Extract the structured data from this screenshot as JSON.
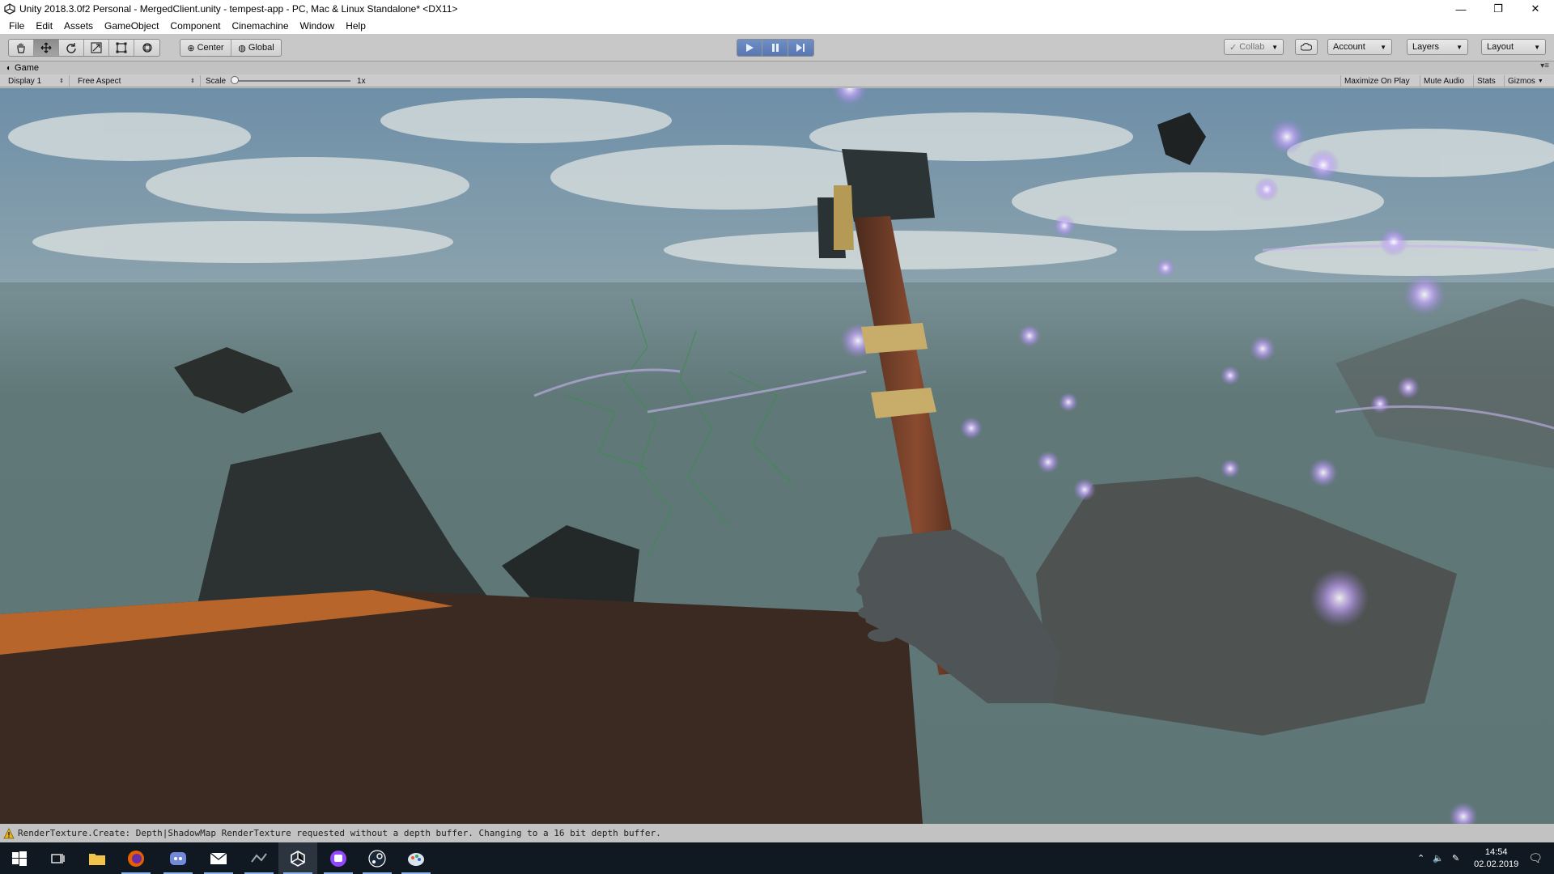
{
  "window": {
    "title": "Unity 2018.3.0f2 Personal - MergedClient.unity - tempest-app - PC, Mac & Linux Standalone* <DX11>",
    "minimize": "—",
    "maximize": "❐",
    "close": "✕"
  },
  "menu": [
    "File",
    "Edit",
    "Assets",
    "GameObject",
    "Component",
    "Cinemachine",
    "Window",
    "Help"
  ],
  "toolbar": {
    "tools": [
      "hand-tool",
      "move-tool",
      "rotate-tool",
      "scale-tool",
      "rect-tool",
      "transform-tool"
    ],
    "pivot": "Center",
    "space": "Global",
    "collab": "Collab",
    "account": "Account",
    "layers": "Layers",
    "layout": "Layout"
  },
  "game_tab": {
    "label": "Game",
    "display": "Display 1",
    "aspect": "Free Aspect",
    "scale_label": "Scale",
    "scale_value": "1x",
    "maximize_on_play": "Maximize On Play",
    "mute_audio": "Mute Audio",
    "stats": "Stats",
    "gizmos": "Gizmos"
  },
  "status": {
    "message": "RenderTexture.Create: Depth|ShadowMap RenderTexture requested without a depth buffer. Changing to a 16 bit depth buffer."
  },
  "taskbar": {
    "apps": [
      "start-icon",
      "task-view-icon",
      "file-explorer-icon",
      "firefox-icon",
      "discord-icon",
      "mail-icon",
      "app-icon",
      "unity-icon",
      "twitch-icon",
      "steam-icon",
      "paint-icon"
    ],
    "time": "14:54",
    "date": "02.02.2019"
  },
  "colors": {
    "play_accent": "#5876b0",
    "taskbar": "#101822"
  }
}
